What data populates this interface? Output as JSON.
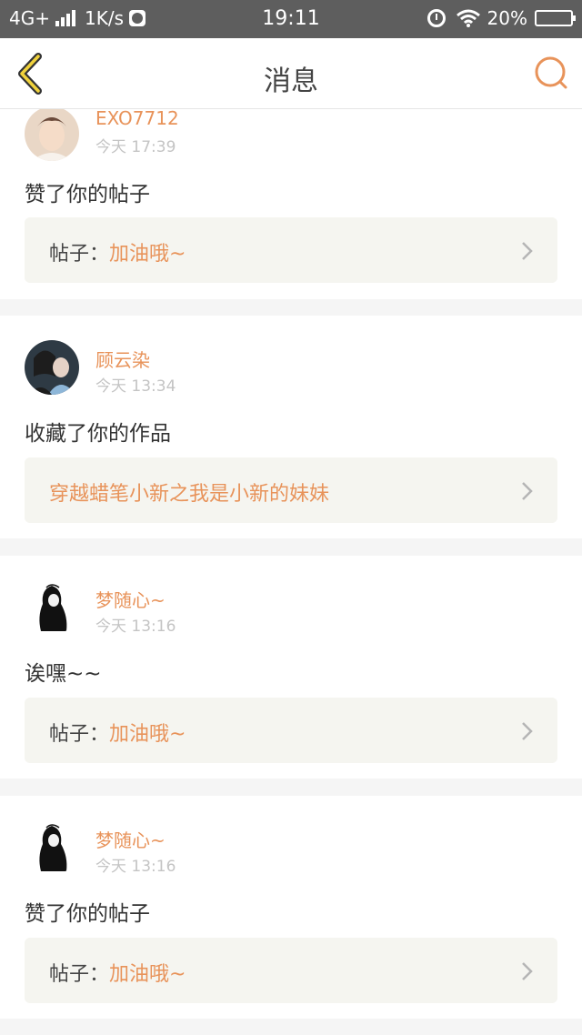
{
  "status_bar": {
    "network": "4G+",
    "speed": "1K/s",
    "time": "19:11",
    "battery": "20%"
  },
  "nav": {
    "title": "消息",
    "accent": "#e8935a"
  },
  "messages": [
    {
      "username": "EXO7712",
      "time": "今天 17:39",
      "text": "赞了你的帖子",
      "ref_prefix": "帖子：",
      "ref_name": "加油哦~",
      "avatar": "avatar-photo-boy"
    },
    {
      "username": "顾云染",
      "time": "今天 13:34",
      "text": "收藏了你的作品",
      "ref_prefix": "",
      "ref_name": "穿越蜡笔小新之我是小新的妹妹",
      "avatar": "avatar-photo-couple"
    },
    {
      "username": "梦随心~",
      "time": "今天 13:16",
      "text": "诶嘿~~",
      "ref_prefix": "帖子：",
      "ref_name": "加油哦~",
      "avatar": "avatar-drawing-girl"
    },
    {
      "username": "梦随心~",
      "time": "今天 13:16",
      "text": "赞了你的帖子",
      "ref_prefix": "帖子：",
      "ref_name": "加油哦~",
      "avatar": "avatar-drawing-girl"
    }
  ]
}
